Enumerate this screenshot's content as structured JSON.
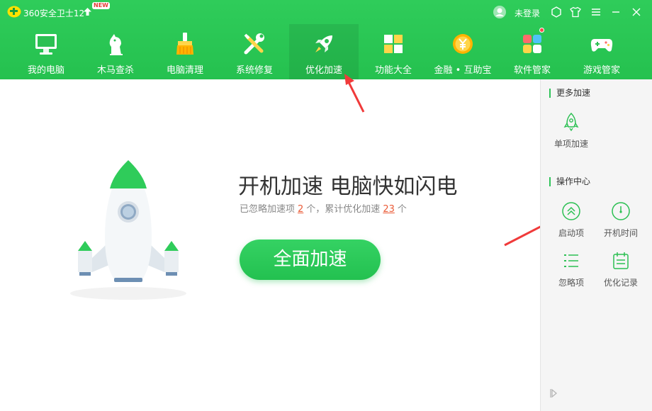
{
  "app": {
    "title": "360安全卫士12",
    "new_badge": "NEW",
    "login": "未登录",
    "brand_color": "#2fcc5a"
  },
  "nav": [
    {
      "label": "我的电脑",
      "icon": "computer-icon"
    },
    {
      "label": "木马查杀",
      "icon": "horse-icon"
    },
    {
      "label": "电脑清理",
      "icon": "broom-icon"
    },
    {
      "label": "系统修复",
      "icon": "wrench-icon"
    },
    {
      "label": "优化加速",
      "icon": "rocket-icon",
      "active": true
    },
    {
      "label": "功能大全",
      "icon": "grid-icon"
    },
    {
      "label": "金融 • 互助宝",
      "icon": "coin-icon"
    },
    {
      "label": "软件管家",
      "icon": "apps-icon"
    },
    {
      "label": "游戏管家",
      "icon": "gamepad-icon"
    }
  ],
  "main": {
    "headline": "开机加速 电脑快如闪电",
    "sub_prefix": "已忽略加速项",
    "ignored_count": "2",
    "sub_mid": "个，累计优化加速",
    "optimized_count": "23",
    "sub_suffix": "个",
    "speed_button": "全面加速"
  },
  "side": {
    "more_title": "更多加速",
    "single_item": "单项加速",
    "ops_title": "操作中心",
    "startup": "启动项",
    "boot_time": "开机时间",
    "ignored": "忽略项",
    "history": "优化记录"
  }
}
